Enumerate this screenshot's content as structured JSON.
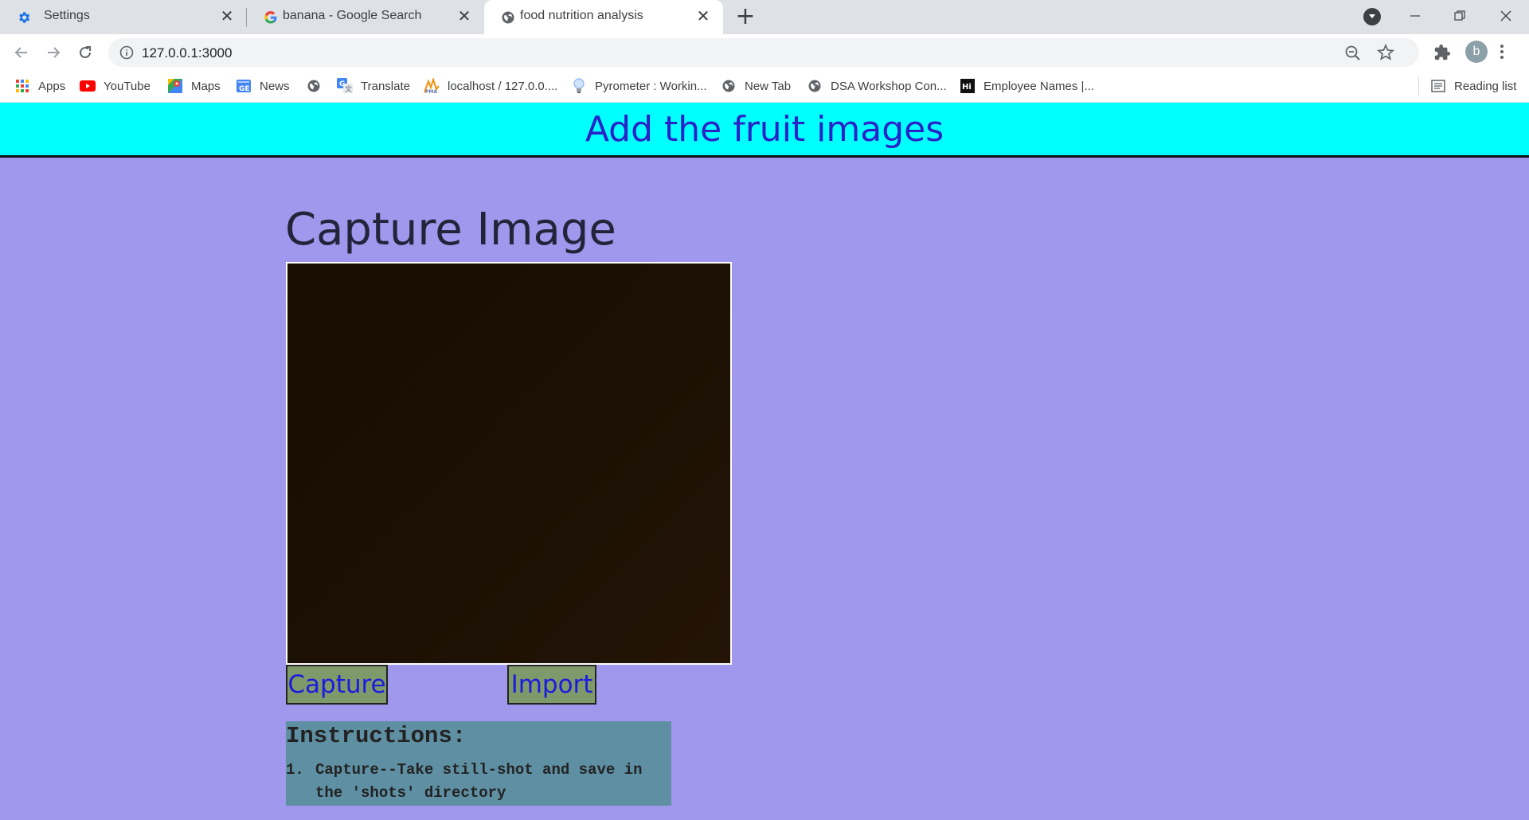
{
  "browser": {
    "tabs": [
      {
        "title": "Settings",
        "icon": "gear-icon"
      },
      {
        "title": "banana - Google Search",
        "icon": "google-icon"
      },
      {
        "title": "food nutrition analysis",
        "icon": "globe-icon",
        "active": true
      }
    ],
    "url": "127.0.0.1:3000",
    "avatar_letter": "b",
    "bookmarks": [
      {
        "label": "Apps",
        "icon": "apps-grid-icon"
      },
      {
        "label": "YouTube",
        "icon": "youtube-icon"
      },
      {
        "label": "Maps",
        "icon": "maps-icon"
      },
      {
        "label": "News",
        "icon": "news-icon"
      },
      {
        "label": "",
        "icon": "globe-icon"
      },
      {
        "label": "Translate",
        "icon": "translate-icon"
      },
      {
        "label": "localhost / 127.0.0....",
        "icon": "phpmyadmin-icon"
      },
      {
        "label": "Pyrometer : Workin...",
        "icon": "bulb-icon"
      },
      {
        "label": "New Tab",
        "icon": "globe-icon"
      },
      {
        "label": "DSA Workshop Con...",
        "icon": "globe-icon"
      },
      {
        "label": "Employee Names |...",
        "icon": "hi-icon"
      }
    ],
    "reading_list": "Reading list"
  },
  "page": {
    "banner_title": "Add the fruit images",
    "heading": "Capture Image",
    "capture_button": "Capture",
    "import_button": "Import",
    "instructions_title": "Instructions:",
    "instructions": [
      {
        "num": "1.",
        "line1": "Capture--Take still-shot and save in",
        "line2": "the 'shots' directory"
      }
    ]
  },
  "colors": {
    "page_bg": "#9f98ec",
    "banner_bg": "#00ffff",
    "banner_text": "#2b22c8",
    "button_bg": "#7f9a6a",
    "button_text": "#1b1be0",
    "instructions_bg": "#5e8fa2"
  }
}
